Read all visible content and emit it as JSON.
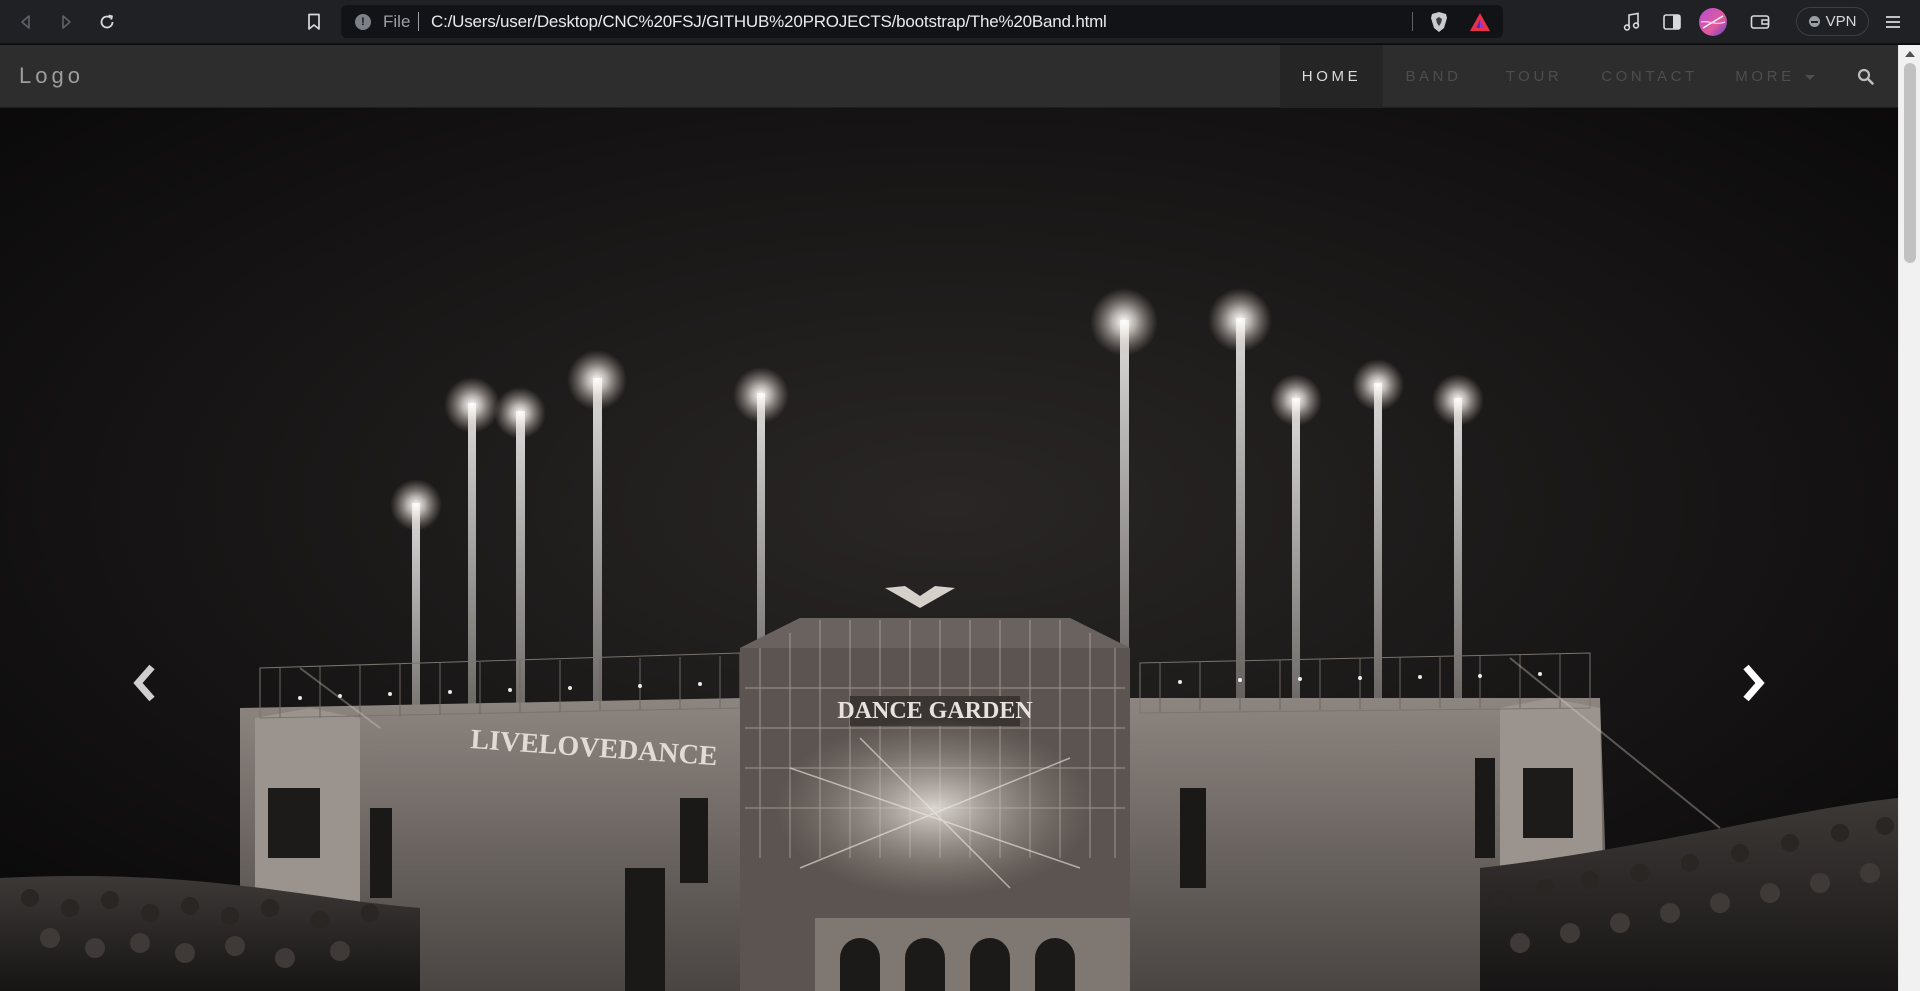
{
  "browser": {
    "scheme_label": "File",
    "url": "C:/Users/user/Desktop/CNC%20FSJ/GITHUB%20PROJECTS/bootstrap/The%20Band.html",
    "vpn_label": "VPN",
    "icons": [
      "back-icon",
      "forward-icon",
      "reload-icon",
      "bookmark-icon",
      "info-icon",
      "brave-shield-icon",
      "brave-rewards-icon",
      "music-icon",
      "sidebar-icon",
      "profile-avatar",
      "wallet-icon",
      "menu-icon"
    ]
  },
  "site": {
    "logo": "Logo",
    "nav": [
      {
        "label": "HOME",
        "active": true
      },
      {
        "label": "BAND",
        "active": false
      },
      {
        "label": "TOUR",
        "active": false
      },
      {
        "label": "CONTACT",
        "active": false
      },
      {
        "label": "MORE",
        "active": false
      }
    ],
    "search_icon": "search-icon"
  },
  "carousel": {
    "stage_banner": "DANCE GARDEN",
    "side_banner": "LIVELOVEDANCE",
    "controls": [
      "chevron-left-icon",
      "chevron-right-icon"
    ]
  },
  "colors": {
    "chrome_bg": "#202124",
    "omnibox_bg": "#111316",
    "navbar_bg": "#2d2d2d",
    "nav_active_bg": "#252525",
    "nav_text": "#4d4d4d",
    "nav_active_text": "#dcdcdc"
  }
}
